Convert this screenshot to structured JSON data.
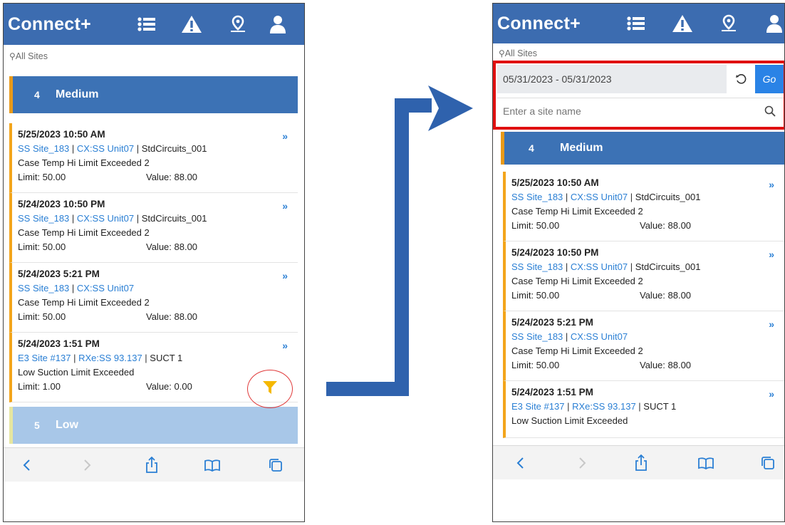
{
  "app": {
    "title": "Connect+"
  },
  "location": {
    "pin": "⚲",
    "label": "All Sites"
  },
  "filter": {
    "date_range": "05/31/2023 - 05/31/2023",
    "go_label": "Go",
    "site_placeholder": "Enter a site name"
  },
  "groups": [
    {
      "count": "4",
      "label": "Medium"
    },
    {
      "count": "5",
      "label": "Low"
    }
  ],
  "alarms": [
    {
      "date": "5/25/2023 10:50 AM",
      "site": "SS Site_183",
      "device": "CX:SS Unit07",
      "point": "StdCircuits_001",
      "desc": "Case Temp Hi Limit Exceeded 2",
      "limit": "Limit:  50.00",
      "value": "Value:  88.00"
    },
    {
      "date": "5/24/2023 10:50 PM",
      "site": "SS Site_183",
      "device": "CX:SS Unit07",
      "point": "StdCircuits_001",
      "desc": "Case Temp Hi Limit Exceeded 2",
      "limit": "Limit:  50.00",
      "value": "Value:  88.00"
    },
    {
      "date": "5/24/2023 5:21 PM",
      "site": "SS Site_183",
      "device": "CX:SS Unit07",
      "point": "",
      "desc": "Case Temp Hi Limit Exceeded 2",
      "limit": "Limit:  50.00",
      "value": "Value:  88.00"
    },
    {
      "date": "5/24/2023 1:51 PM",
      "site": "E3 Site #137",
      "device": "RXe:SS 93.137",
      "point": "SUCT 1",
      "desc": "Low Suction Limit Exceeded",
      "limit": "Limit:  1.00",
      "value": "Value:  0.00"
    }
  ],
  "separators": {
    "pipe": " | "
  },
  "chevron": "»",
  "colors": {
    "appbar": "#3c6cb0",
    "medium_group": "#3c72b5",
    "low_group": "#a8c7e8",
    "accent_orange": "#f3a51b",
    "link_blue": "#2a7fd4",
    "filter_yellow": "#f5b800",
    "highlight_red": "#e01010",
    "arrow_blue": "#2f62ad"
  },
  "icons": {
    "header": [
      "list-icon",
      "warning-icon",
      "map-pin-icon",
      "user-icon"
    ],
    "browser": [
      "back-icon",
      "forward-icon",
      "share-icon",
      "bookmarks-icon",
      "tabs-icon"
    ],
    "filter": "filter-icon"
  }
}
